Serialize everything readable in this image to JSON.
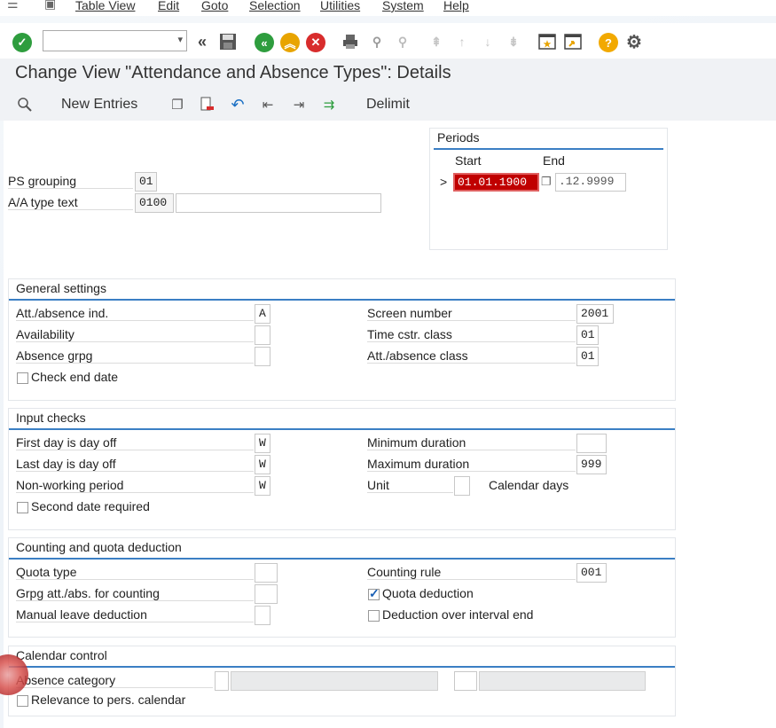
{
  "menu": {
    "items": [
      "Table View",
      "Edit",
      "Goto",
      "Selection",
      "Utilities",
      "System",
      "Help"
    ]
  },
  "toolbar": {
    "command_field_value": "",
    "icons": [
      "enter-icon",
      "save-icon",
      "back-icon",
      "exit-icon",
      "cancel-icon",
      "print-icon",
      "find-icon",
      "find-next-icon",
      "first-page-icon",
      "previous-page-icon",
      "next-page-icon",
      "last-page-icon",
      "create-session-icon",
      "shortcut-icon",
      "help-icon",
      "customize-layout-icon"
    ]
  },
  "title": "Change View \"Attendance and Absence Types\": Details",
  "app_toolbar": {
    "new_entries": "New Entries",
    "delimit": "Delimit"
  },
  "header": {
    "ps_grouping_label": "PS grouping",
    "ps_grouping_value": "01",
    "aa_type_text_label": "A/A type text",
    "aa_type_value": "0100",
    "aa_type_text_value": ""
  },
  "periods": {
    "title": "Periods",
    "start_label": "Start",
    "end_label": "End",
    "marker": ">",
    "start_value": "01.01.1900",
    "end_value": ".12.9999"
  },
  "general": {
    "title": "General settings",
    "att_abs_ind_label": "Att./absence ind.",
    "att_abs_ind_value": "A",
    "availability_label": "Availability",
    "availability_value": "",
    "absence_grpg_label": "Absence grpg",
    "absence_grpg_value": "",
    "check_end_date_label": "Check end date",
    "check_end_date_checked": false,
    "screen_number_label": "Screen number",
    "screen_number_value": "2001",
    "time_cstr_label": "Time cstr. class",
    "time_cstr_value": "01",
    "att_abs_class_label": "Att./absence class",
    "att_abs_class_value": "01"
  },
  "input_checks": {
    "title": "Input checks",
    "first_day_label": "First day is day off",
    "first_day_value": "W",
    "last_day_label": "Last day is day off",
    "last_day_value": "W",
    "non_working_label": "Non-working period",
    "non_working_value": "W",
    "second_date_label": "Second date required",
    "second_date_checked": false,
    "min_duration_label": "Minimum duration",
    "min_duration_value": "",
    "max_duration_label": "Maximum duration",
    "max_duration_value": "999",
    "unit_label": "Unit",
    "unit_value": "",
    "unit_text": "Calendar days"
  },
  "counting": {
    "title": "Counting and quota deduction",
    "quota_type_label": "Quota type",
    "quota_type_value": "",
    "grpg_counting_label": "Grpg att./abs. for counting",
    "grpg_counting_value": "",
    "manual_leave_label": "Manual leave deduction",
    "manual_leave_value": "",
    "counting_rule_label": "Counting rule",
    "counting_rule_value": "001",
    "quota_deduction_label": "Quota deduction",
    "quota_deduction_checked": true,
    "deduction_over_label": "Deduction over interval end",
    "deduction_over_checked": false
  },
  "calendar": {
    "title": "Calendar control",
    "absence_category_label": "Absence category",
    "absence_category_value": "",
    "relevance_label": "Relevance to pers. calendar",
    "relevance_checked": false
  },
  "colors": {
    "accent": "#3b7fc4",
    "enter_green": "#2e9d3e",
    "selected_red": "#c00000",
    "help_orange": "#f2a900"
  }
}
